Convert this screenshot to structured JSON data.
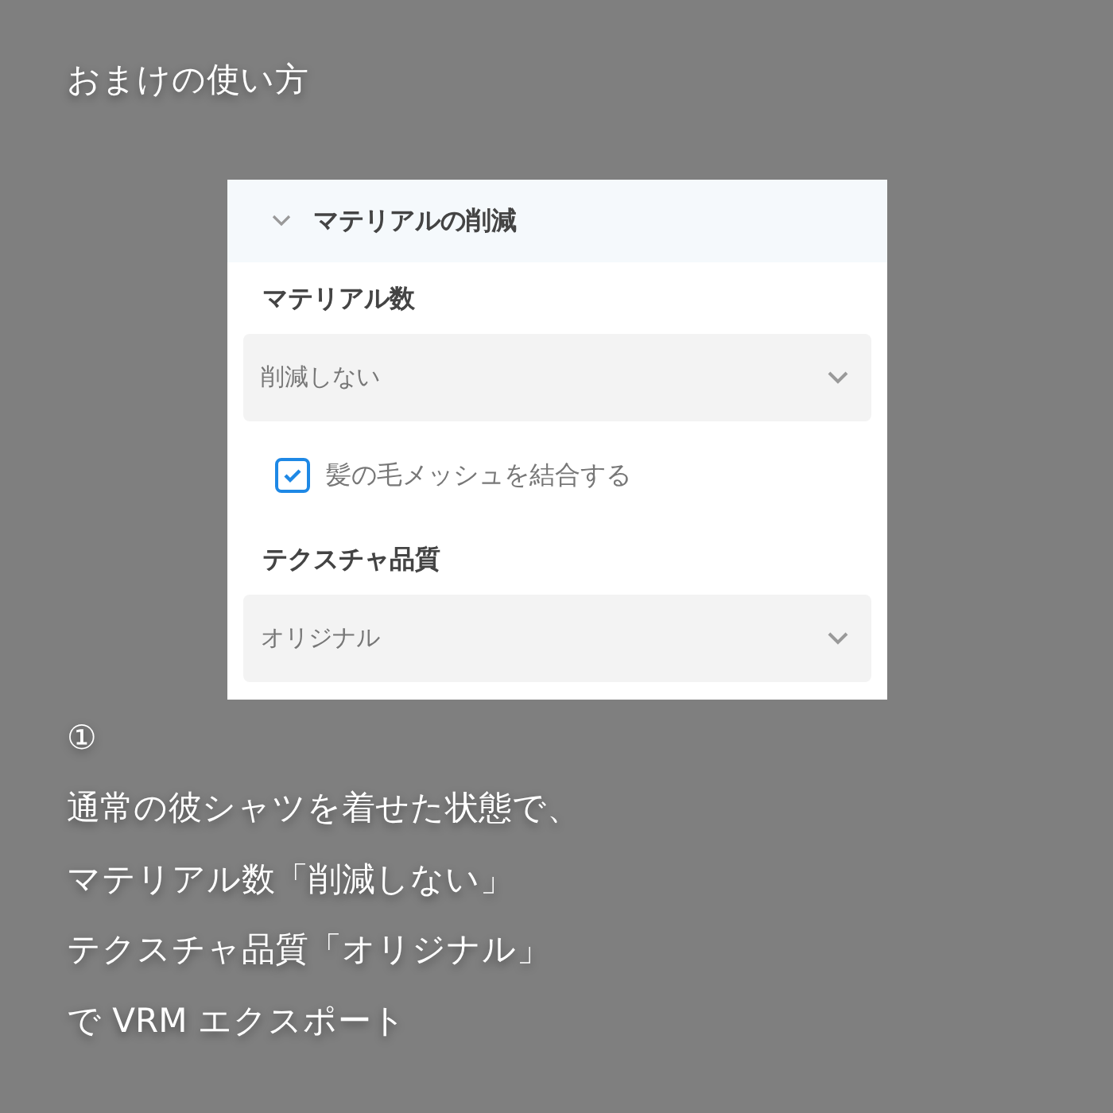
{
  "title": "おまけの使い方",
  "panel": {
    "section_title": "マテリアルの削減",
    "expanded": true,
    "items": [
      {
        "kind": "select",
        "label": "マテリアル数",
        "value": "削減しない"
      },
      {
        "kind": "checkbox",
        "label": "髪の毛メッシュを結合する",
        "checked": true
      },
      {
        "kind": "select",
        "label": "テクスチャ品質",
        "value": "オリジナル"
      }
    ]
  },
  "caption": {
    "step": "①",
    "lines": [
      "通常の彼シャツを着せた状態で、",
      "マテリアル数「削減しない」",
      "テクスチャ品質「オリジナル」",
      "で VRM エクスポート"
    ]
  }
}
